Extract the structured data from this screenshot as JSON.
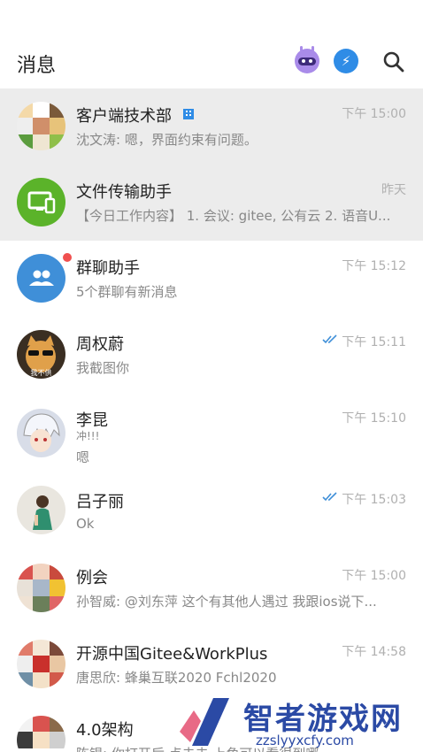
{
  "header": {
    "title": "消息",
    "robot_icon": "robot-icon",
    "flash_icon": "lightning-icon",
    "search_icon": "search-icon"
  },
  "conversations": [
    {
      "name": "客户端技术部",
      "time": "下午 15:00",
      "preview": "沈文涛: 嗯，界面约束有问题。",
      "avatar": "group-collage-avatar",
      "badge": "enterprise-badge-icon",
      "highlighted": true
    },
    {
      "name": "文件传输助手",
      "time": "昨天",
      "preview": "【今日工作内容】 1. 会议: gitee, 公有云 2. 语音U...",
      "avatar": "file-transfer-icon",
      "highlighted": true
    },
    {
      "name": "群聊助手",
      "time": "下午 15:12",
      "preview": "5个群聊有新消息",
      "avatar": "group-chat-icon",
      "unread": true
    },
    {
      "name": "周权蔚",
      "time": "下午 15:11",
      "preview": "我截图你",
      "avatar": "cat-avatar",
      "read_check": "double-check-icon",
      "avatar_caption": "我不供"
    },
    {
      "name": "李昆",
      "time": "下午 15:10",
      "preview_line1": "冲!!!",
      "preview_line2": "嗯",
      "avatar": "anime-avatar"
    },
    {
      "name": "吕子丽",
      "time": "下午 15:03",
      "preview": "Ok",
      "avatar": "photo-avatar",
      "read_check": "double-check-icon"
    },
    {
      "name": "例会",
      "time": "下午 15:00",
      "preview": "孙智威: @刘东萍 这个有其他人遇过 我跟ios说下...",
      "avatar": "group-collage-avatar"
    },
    {
      "name": "开源中国Gitee&WorkPlus",
      "time": "下午 14:58",
      "preview": "唐思欣: 蜂巢互联2020 Fchl2020",
      "avatar": "group-collage-avatar"
    },
    {
      "name": "4.0架构",
      "time": "",
      "preview": "陈锡: 你打开后 点击去 上角可以看很到哪",
      "avatar": "group-collage-avatar"
    }
  ],
  "watermark": {
    "title": "智者游戏网",
    "url": "zzslyyxcfy.com"
  },
  "colors": {
    "highlight_bg": "#ececec",
    "time": "#b0b0b0",
    "preview": "#888888",
    "accent_blue": "#2f8ce6",
    "green": "#5bb32a",
    "unread": "#f0504f"
  }
}
